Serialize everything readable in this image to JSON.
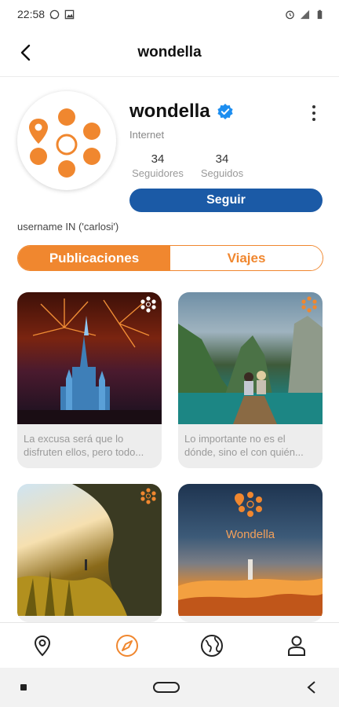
{
  "status_bar": {
    "time": "22:58"
  },
  "header": {
    "title": "wondella"
  },
  "profile": {
    "name": "wondella",
    "category": "Internet",
    "followers": {
      "count": "34",
      "label": "Seguidores"
    },
    "following": {
      "count": "34",
      "label": "Seguidos"
    },
    "follow_button": "Seguir",
    "bio": "username IN ('carlosi')"
  },
  "tabs": [
    {
      "label": "Publicaciones",
      "active": true
    },
    {
      "label": "Viajes",
      "active": false
    }
  ],
  "posts": [
    {
      "caption": "La excusa será que lo disfruten ellos, pero todo..."
    },
    {
      "caption": "Lo importante no es el dónde, sino el con quién..."
    },
    {
      "caption": ""
    },
    {
      "caption": "",
      "image_text": "Wondella"
    }
  ],
  "bottom_nav": [
    "location-icon",
    "compass-icon",
    "globe-icon",
    "profile-icon"
  ],
  "colors": {
    "accent": "#f0872f",
    "primary": "#1b5aa6",
    "verified": "#1d8ef0"
  }
}
